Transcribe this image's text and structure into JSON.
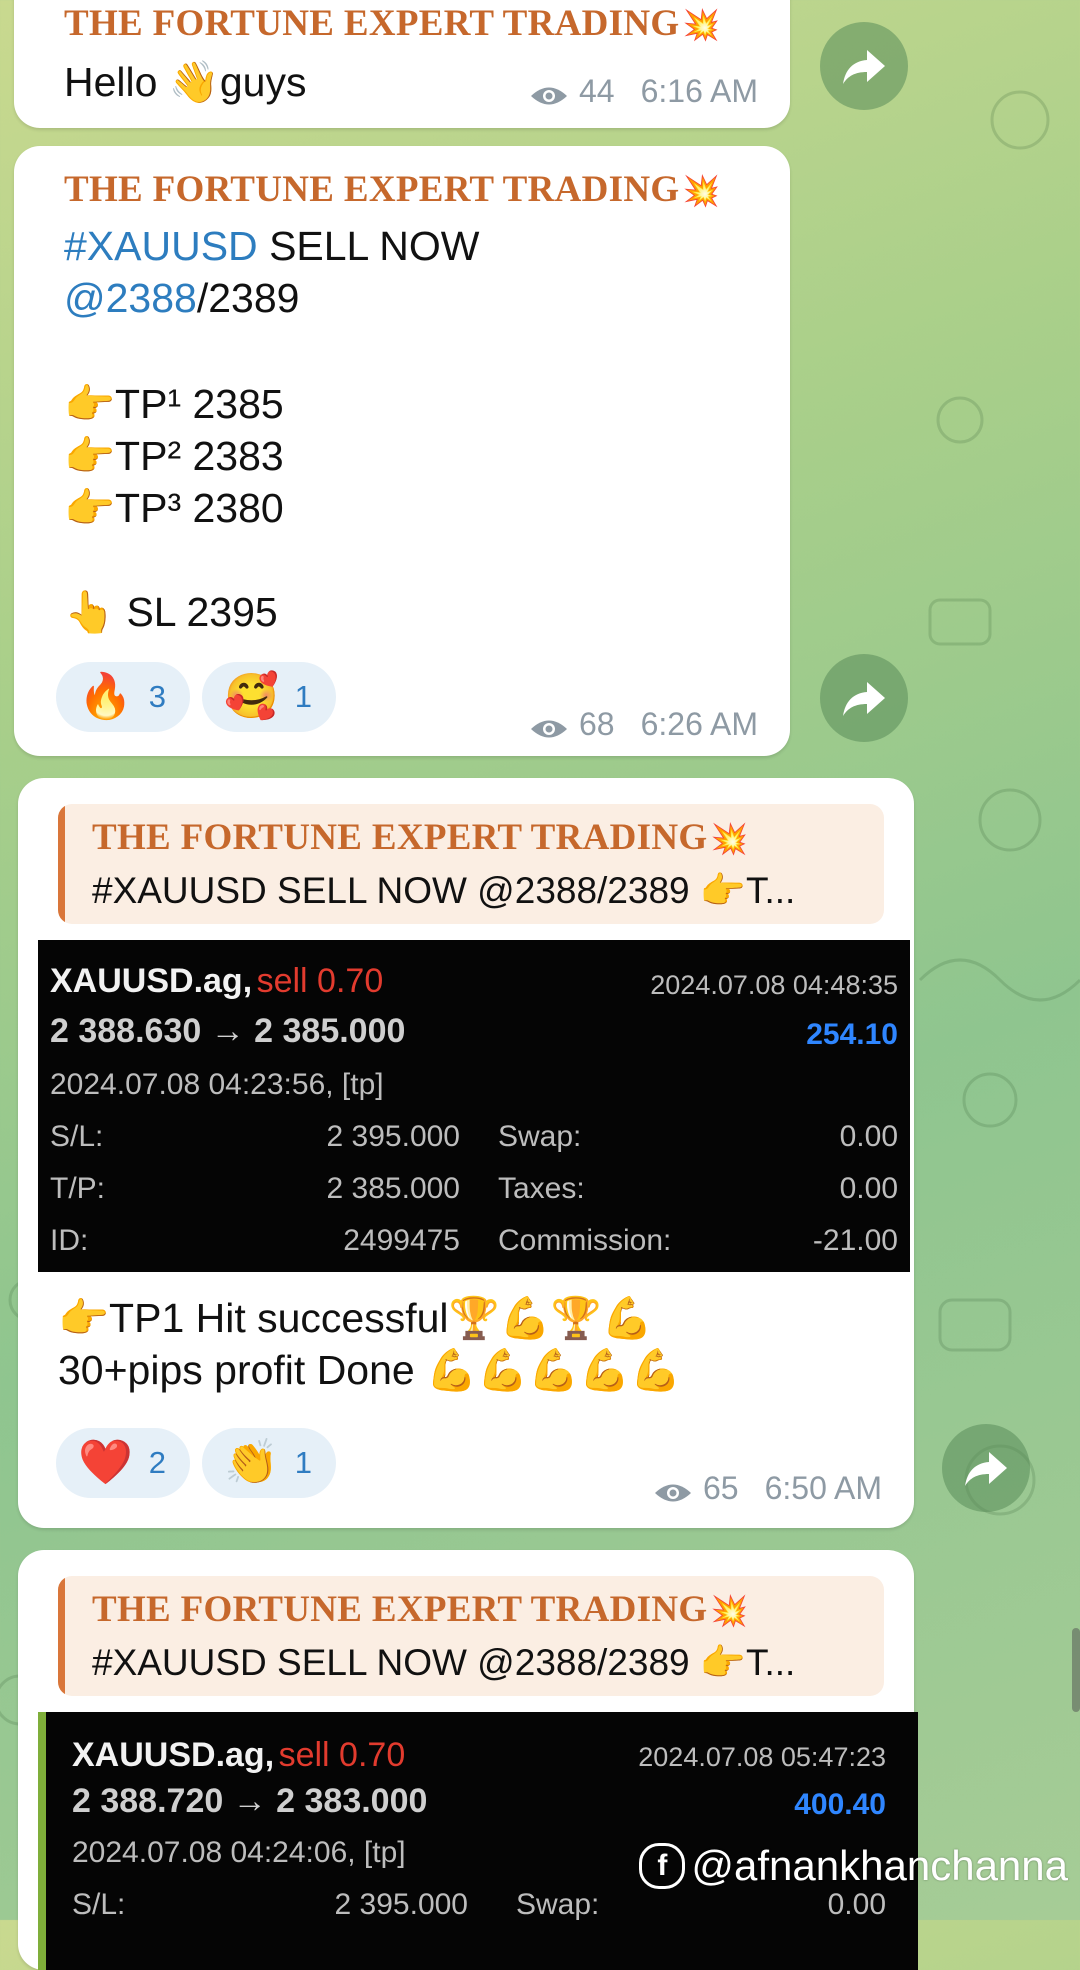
{
  "channel_title": "THE FORTUNE EXPERT TRADING",
  "messages": [
    {
      "text": "Hello 👋guys",
      "views": "44",
      "time": "6:16 AM"
    },
    {
      "line1_tag": "#XAUUSD",
      "line1_rest": " SELL NOW",
      "line2_link": "@2388",
      "line2_rest": "/2389",
      "tp1": "👉TP¹ 2385",
      "tp2": "👉TP² 2383",
      "tp3": "👉TP³ 2380",
      "sl": "👆 SL 2395",
      "reactions": [
        {
          "emoji": "🔥",
          "count": "3"
        },
        {
          "emoji": "🥰",
          "count": "1"
        }
      ],
      "views": "68",
      "time": "6:26 AM"
    },
    {
      "quote_text": "#XAUUSD SELL NOW @2388/2389  👉T...",
      "trade": {
        "symbol": "XAUUSD.ag,",
        "side": "sell 0.70",
        "close_time": "2024.07.08 04:48:35",
        "prices": "2 388.630 → 2 385.000",
        "profit": "254.10",
        "open_time": "2024.07.08 04:23:56, [tp]",
        "sl_label": "S/L:",
        "sl_value": "2 395.000",
        "tp_label": "T/P:",
        "tp_value": "2 385.000",
        "id_label": "ID:",
        "id_value": "2499475",
        "swap_label": "Swap:",
        "swap_value": "0.00",
        "taxes_label": "Taxes:",
        "taxes_value": "0.00",
        "commission_label": "Commission:",
        "commission_value": "-21.00"
      },
      "line1": "👉TP1  Hit successful🏆💪🏆💪",
      "line2": "30+pips profit Done 💪💪💪💪💪",
      "reactions": [
        {
          "emoji": "❤️",
          "count": "2"
        },
        {
          "emoji": "👏",
          "count": "1"
        }
      ],
      "views": "65",
      "time": "6:50 AM"
    },
    {
      "quote_text": "#XAUUSD SELL NOW @2388/2389  👉T...",
      "trade": {
        "symbol": "XAUUSD.ag,",
        "side": "sell 0.70",
        "close_time": "2024.07.08 05:47:23",
        "prices": "2 388.720 → 2 383.000",
        "profit": "400.40",
        "open_time": "2024.07.08 04:24:06, [tp]",
        "sl_label": "S/L:",
        "sl_value": "2 395.000",
        "swap_label": "Swap:",
        "swap_value": "0.00"
      }
    }
  ],
  "watermark": "@afnankhanchanna",
  "colors": {
    "title": "#c6682c",
    "link": "#2d7dbf",
    "sell": "#e23b2e",
    "profit": "#2f86ff",
    "reaction_count": "#2f7cc1"
  },
  "icons": [
    "eye-icon",
    "forward-icon",
    "facebook-icon",
    "collision-icon"
  ]
}
